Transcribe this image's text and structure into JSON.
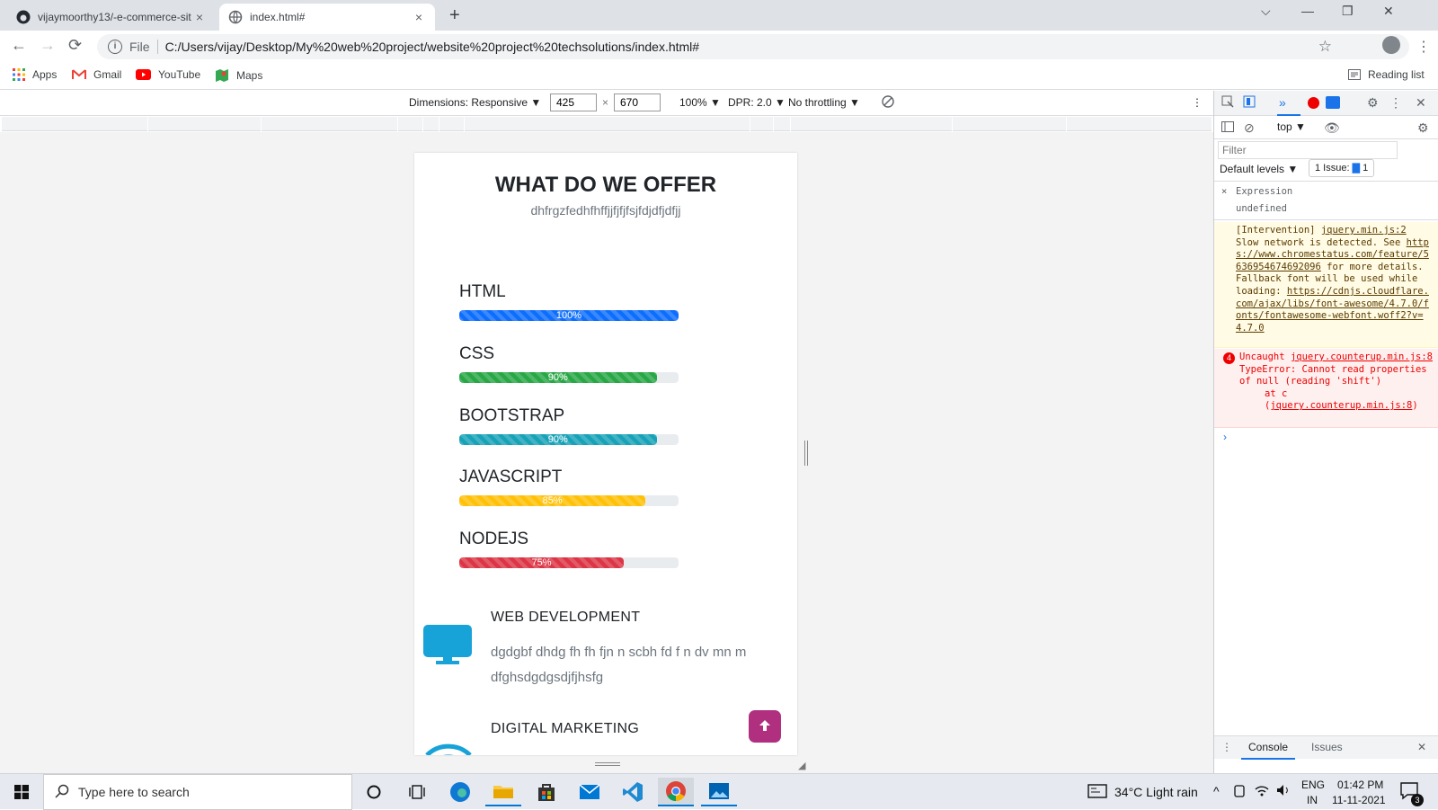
{
  "browser": {
    "tabs": [
      {
        "title": "vijaymoorthy13/-e-commerce-sit",
        "close": "×"
      },
      {
        "title": "index.html#",
        "close": "×"
      }
    ],
    "newtab": "+",
    "window_controls": {
      "collapse": "⌵",
      "minimize": "—",
      "restore": "❐",
      "close": "✕"
    },
    "nav": {
      "back": "←",
      "forward": "→",
      "reload": "⟳"
    },
    "address": {
      "info": "i",
      "scheme": "File",
      "url": "C:/Users/vijay/Desktop/My%20web%20project/website%20project%20techsolutions/index.html#"
    },
    "toolbar_icons": {
      "bookmark": "☆",
      "menu": "⋮"
    },
    "bookmarks": [
      "Apps",
      "Gmail",
      "YouTube",
      "Maps"
    ],
    "reading_list": "Reading list"
  },
  "device_toolbar": {
    "dimensions_label": "Dimensions: Responsive ▼",
    "width": "425",
    "times": "×",
    "height": "670",
    "zoom": "100% ▼",
    "dpr": "DPR: 2.0 ▼",
    "throttling": "No throttling ▼",
    "more": "⋮"
  },
  "page": {
    "heading": "WHAT DO WE OFFER",
    "subheading": "dhfrgzfedhfhffjjfjfjfsjfdjdfjdfjj",
    "skills": [
      {
        "name": "HTML",
        "percent": 100,
        "label": "100%",
        "color": "#0d6efd"
      },
      {
        "name": "CSS",
        "percent": 90,
        "label": "90%",
        "color": "#28a745"
      },
      {
        "name": "BOOTSTRAP",
        "percent": 90,
        "label": "90%",
        "color": "#17a2b8"
      },
      {
        "name": "JAVASCRIPT",
        "percent": 85,
        "label": "85%",
        "color": "#ffc107"
      },
      {
        "name": "NODEJS",
        "percent": 75,
        "label": "75%",
        "color": "#dc3545"
      }
    ],
    "services": [
      {
        "title": "WEB  DEVELOPMENT",
        "desc": "dgdgbf dhdg fh fh fjn n scbh fd f n dv mn m dfghsdgdgsdjfjhsfg",
        "icon": "monitor-icon"
      },
      {
        "title": "DIGITAL  MARKETING",
        "desc": "",
        "icon": "wifi-icon"
      }
    ],
    "accent": "#b0307f",
    "icon_color": "#17a2d8"
  },
  "devtools": {
    "context": "top ▼",
    "filter_placeholder": "Filter",
    "levels": "Default levels ▼",
    "issues": "1 Issue:",
    "issues_count": "1",
    "expression_close": "×",
    "expression_label": "Expression",
    "expression_value": "undefined",
    "warning": {
      "prefix": "[Intervention]",
      "source": "jquery.min.js:2",
      "text1": "Slow network is detected. See",
      "link1": "https://www.chromestatus.com/feature/5636954674692096",
      "text2": "for more details. Fallback font will be used while loading:",
      "link2": "https://cdnjs.cloudflare.com/ajax/libs/font-awesome/4.7.0/fonts/fontawesome-webfont.woff2?v=4.7.0"
    },
    "error": {
      "count": "4",
      "text": "Uncaught TypeError: Cannot read properties of null (reading 'shift')",
      "source": "jquery.counterup.min.js:8",
      "stack_prefix": "at c (",
      "stack_link": "jquery.counterup.min.js:8",
      "stack_suffix": ")"
    },
    "prompt": "›",
    "bottom_tabs": [
      "Console",
      "Issues"
    ],
    "bottom_close": "✕"
  },
  "taskbar": {
    "search_placeholder": "Type here to search",
    "weather": "34°C  Light rain",
    "lang_top": "ENG",
    "lang_bottom": "IN",
    "time": "01:42 PM",
    "date": "11-11-2021",
    "notifications": "3",
    "chevron": "^"
  }
}
